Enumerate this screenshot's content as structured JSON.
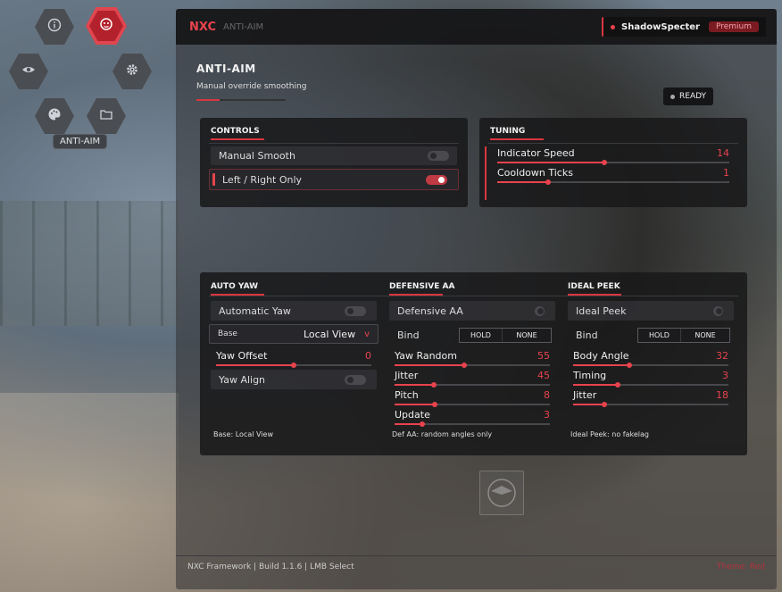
{
  "sidebar": {
    "items": [
      {
        "name": "info",
        "icon": "info-icon",
        "active": false
      },
      {
        "name": "anti-aim",
        "icon": "anti-aim-icon",
        "active": true
      },
      {
        "name": "visuals",
        "icon": "eye-icon",
        "active": false
      },
      {
        "name": "settings",
        "icon": "gear-icon",
        "active": false
      },
      {
        "name": "skins",
        "icon": "palette-icon",
        "active": false
      },
      {
        "name": "configs",
        "icon": "folder-icon",
        "active": false
      }
    ],
    "active_tooltip": "ANTI-AIM"
  },
  "window": {
    "logo": "NXC",
    "title_sub": "ANTI-AIM",
    "user": "ShadowSpecter",
    "badge": "Premium"
  },
  "page": {
    "title": "ANTI-AIM",
    "subtitle": "Manual override smoothing",
    "status": "READY"
  },
  "controls": {
    "heading": "CONTROLS",
    "items": [
      {
        "label": "Manual Smooth",
        "on": false
      },
      {
        "label": "Left / Right Only",
        "on": true
      }
    ]
  },
  "tuning": {
    "heading": "TUNING",
    "sliders": [
      {
        "label": "Indicator Speed",
        "value": "14",
        "fraction": 0.46
      },
      {
        "label": "Cooldown Ticks",
        "value": "1",
        "fraction": 0.22
      }
    ]
  },
  "auto_yaw": {
    "heading": "AUTO YAW",
    "toggle_label": "Automatic Yaw",
    "base_label": "Base",
    "base_value": "Local View",
    "base_caret": "v",
    "slider_label": "Yaw Offset",
    "slider_value": "0",
    "slider_fraction": 0.5,
    "align_label": "Yaw Align",
    "note": "Base: Local View"
  },
  "defensive": {
    "heading": "DEFENSIVE AA",
    "toggle_label": "Defensive AA",
    "bind_label": "Bind",
    "bind_hold": "HOLD",
    "bind_none": "NONE",
    "sliders": [
      {
        "label": "Yaw Random",
        "value": "55",
        "fraction": 0.45
      },
      {
        "label": "Jitter",
        "value": "45",
        "fraction": 0.25
      },
      {
        "label": "Pitch",
        "value": "8",
        "fraction": 0.26
      },
      {
        "label": "Update",
        "value": "3",
        "fraction": 0.18
      }
    ],
    "note": "Def AA: random angles only"
  },
  "ideal_peek": {
    "heading": "IDEAL PEEK",
    "toggle_label": "Ideal Peek",
    "bind_label": "Bind",
    "bind_hold": "HOLD",
    "bind_none": "NONE",
    "sliders": [
      {
        "label": "Body Angle",
        "value": "32",
        "fraction": 0.36
      },
      {
        "label": "Timing",
        "value": "3",
        "fraction": 0.29
      },
      {
        "label": "Jitter",
        "value": "18",
        "fraction": 0.2
      }
    ],
    "note": "Ideal Peek: no fakelag"
  },
  "footer": {
    "left": "NXC Framework | Build 1.1.6 | LMB Select",
    "right": "Theme: Red"
  },
  "colors": {
    "accent": "#e8434d",
    "panel": "#18181a",
    "titlebar": "#161618"
  }
}
